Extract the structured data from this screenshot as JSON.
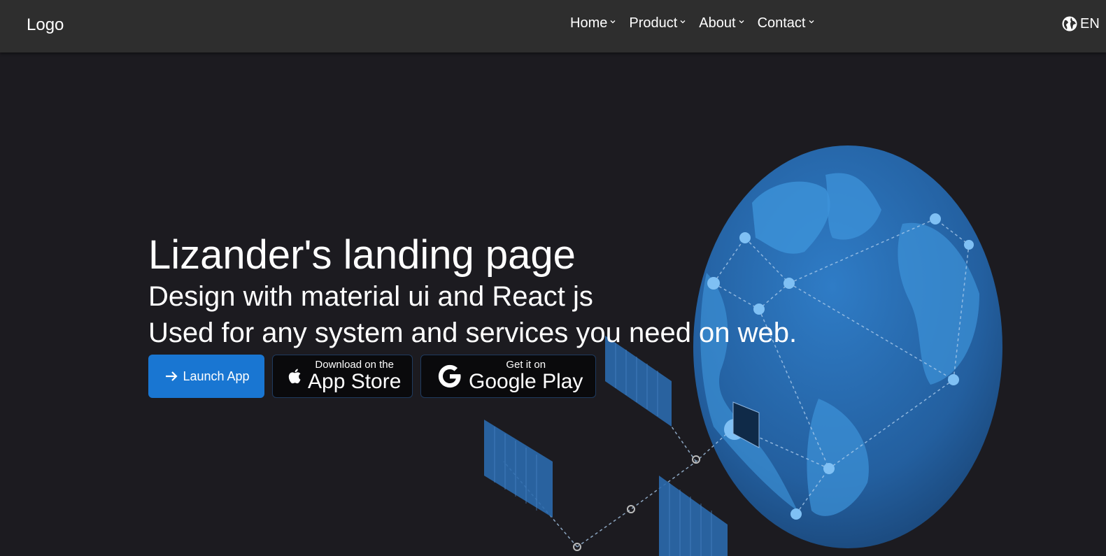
{
  "header": {
    "logo": "Logo",
    "nav": [
      {
        "label": "Home"
      },
      {
        "label": "Product"
      },
      {
        "label": "About"
      },
      {
        "label": "Contact"
      }
    ],
    "language": "EN"
  },
  "hero": {
    "title": "Lizander's landing page",
    "subtitle": "Design with material ui and React js",
    "tagline": "Used for any system and services you need on web."
  },
  "buttons": {
    "launch": "Launch App",
    "app_store_small": "Download on the",
    "app_store_big": "App Store",
    "google_play_small": "Get it on",
    "google_play_big": "Google Play"
  },
  "colors": {
    "background": "#1c1b20",
    "appbar": "#2e2e2e",
    "primary": "#1976d2",
    "globe": "#2a6db5"
  },
  "icons": [
    "chevron-down-icon",
    "globe-icon",
    "arrow-right-icon",
    "apple-icon",
    "google-icon"
  ]
}
